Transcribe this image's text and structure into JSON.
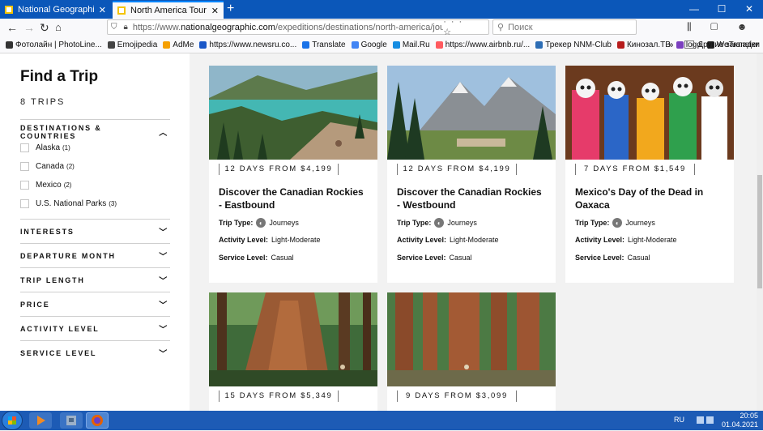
{
  "browser": {
    "tabs": [
      {
        "title": "National Geographic",
        "active": false
      },
      {
        "title": "North America Tours: USA, Ca",
        "active": true
      }
    ],
    "url_base": "https://www.",
    "url_domain": "nationalgeographic.com",
    "url_path": "/expeditions/destinations/north-america/journeys/",
    "search_placeholder": "Поиск",
    "url_actions": "··· ☆",
    "bookmarks": [
      {
        "label": "Фотолайн | PhotoLine...",
        "color": "#333"
      },
      {
        "label": "Emojipedia",
        "color": "#444"
      },
      {
        "label": "AdMe",
        "color": "#f5a000"
      },
      {
        "label": "https://www.newsru.co...",
        "color": "#1a57c7"
      },
      {
        "label": "Translate",
        "color": "#1a73e8"
      },
      {
        "label": "Google",
        "color": "#4285f4"
      },
      {
        "label": "Mail.Ru",
        "color": "#168de2"
      },
      {
        "label": "https://www.airbnb.ru/...",
        "color": "#ff5a5f"
      },
      {
        "label": "Трекер NNM-Club",
        "color": "#2d6db5"
      },
      {
        "label": "Кинозал.ТВ",
        "color": "#b71c1c"
      },
      {
        "label": "logo",
        "color": "#7b3fbf"
      },
      {
        "label": "WeTransfer",
        "color": "#222"
      }
    ],
    "other_bookmarks": "Другие закладки"
  },
  "sidebar": {
    "title": "Find a Trip",
    "trip_count": "8 TRIPS",
    "destinations_heading": "DESTINATIONS & COUNTRIES",
    "destinations": [
      {
        "label": "Alaska",
        "count": "(1)"
      },
      {
        "label": "Canada",
        "count": "(2)"
      },
      {
        "label": "Mexico",
        "count": "(2)"
      },
      {
        "label": "U.S. National Parks",
        "count": "(3)"
      }
    ],
    "filters": [
      "INTERESTS",
      "DEPARTURE MONTH",
      "TRIP LENGTH",
      "PRICE",
      "ACTIVITY LEVEL",
      "SERVICE LEVEL"
    ]
  },
  "labels": {
    "trip_type": "Trip Type:",
    "activity_level": "Activity Level:",
    "service_level": "Service Level:"
  },
  "cards": [
    {
      "duration": "12 DAYS FROM $4,199",
      "title": "Discover the Canadian Rockies - Eastbound",
      "trip_type": "Journeys",
      "activity": "Light-Moderate",
      "service": "Casual"
    },
    {
      "duration": "12 DAYS FROM $4,199",
      "title": "Discover the Canadian Rockies - Westbound",
      "trip_type": "Journeys",
      "activity": "Light-Moderate",
      "service": "Casual"
    },
    {
      "duration": "7 DAYS FROM $1,549",
      "title": "Mexico's Day of the Dead in Oaxaca",
      "trip_type": "Journeys",
      "activity": "Light-Moderate",
      "service": "Casual"
    },
    {
      "duration": "15 DAYS FROM $5,349"
    },
    {
      "duration": "9 DAYS FROM $3,099"
    }
  ],
  "taskbar": {
    "lang": "RU",
    "time": "20:05",
    "date": "01.04.2021"
  }
}
